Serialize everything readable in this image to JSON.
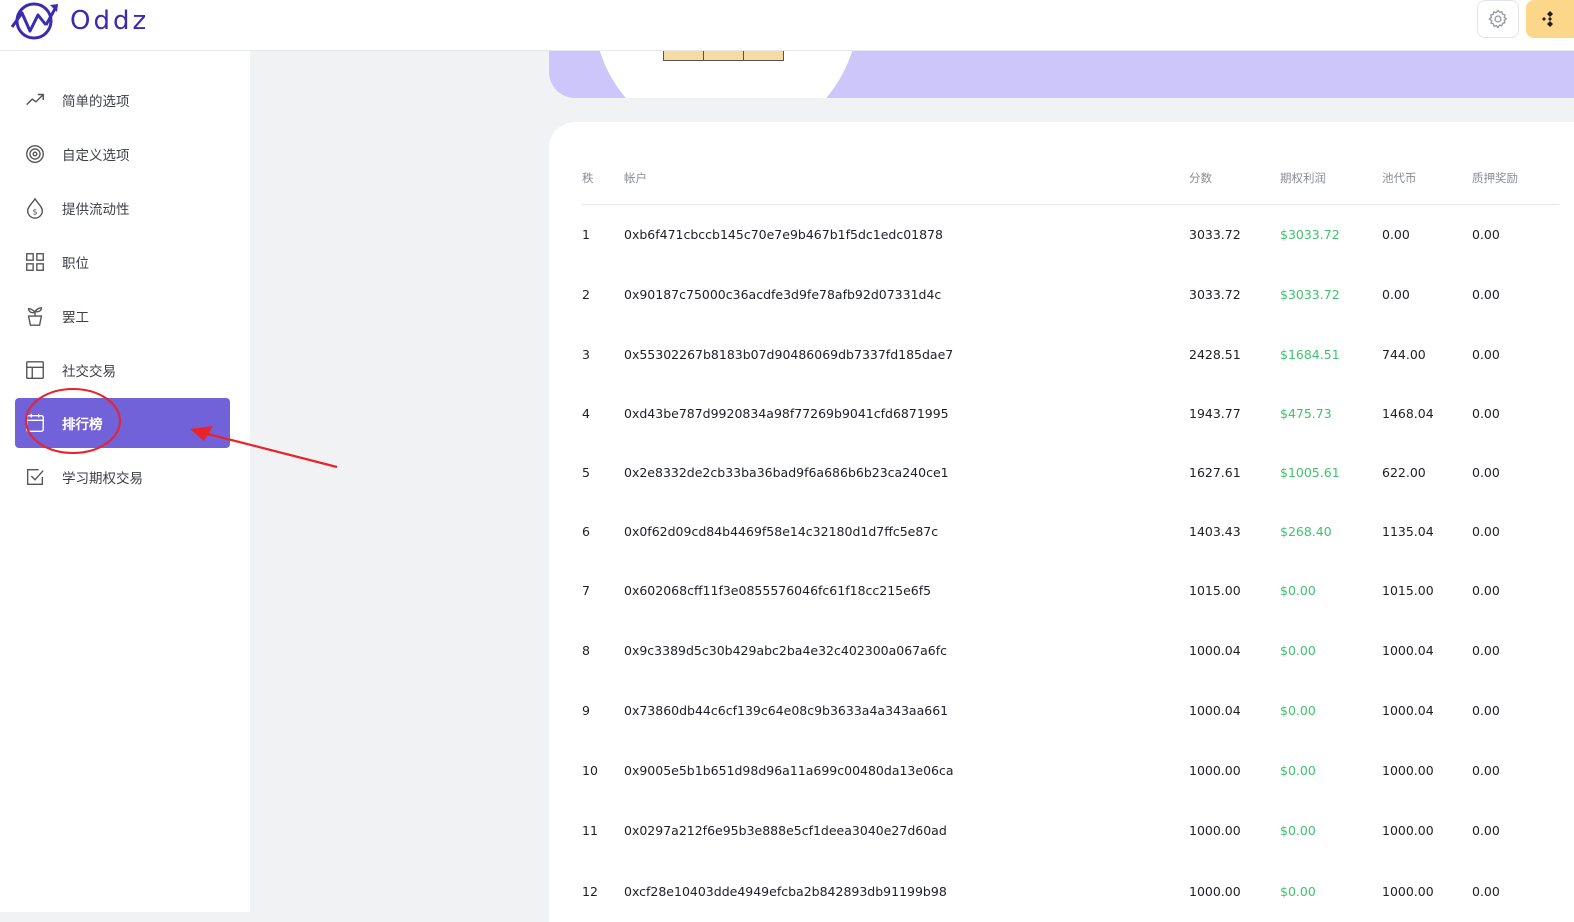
{
  "app": {
    "brand": "Oddz"
  },
  "colors": {
    "accent": "#7162d9",
    "profit_green": "#3ec46d",
    "banner": "#cdc6fb",
    "wallet": "#fcd78a",
    "annotation_red": "#e8232a"
  },
  "header": {
    "settings_icon": "gear-icon",
    "wallet_icon": "binance-icon"
  },
  "sidebar": {
    "items": [
      {
        "label": "简单的选项",
        "icon": "trending-up-icon"
      },
      {
        "label": "自定义选项",
        "icon": "target-icon"
      },
      {
        "label": "提供流动性",
        "icon": "dollar-drop-icon"
      },
      {
        "label": "职位",
        "icon": "grid-icon"
      },
      {
        "label": "罢工",
        "icon": "plant-pot-icon"
      },
      {
        "label": "社交交易",
        "icon": "layout-icon"
      },
      {
        "label": "排行榜",
        "icon": "calendar-icon",
        "active": true
      },
      {
        "label": "学习期权交易",
        "icon": "checkbox-icon"
      }
    ]
  },
  "leaderboard": {
    "columns": {
      "rank": "秩",
      "account": "帐户",
      "score": "分数",
      "option_profit": "期权利润",
      "pool_token": "池代币",
      "stake_reward": "质押奖励"
    },
    "rows": [
      {
        "rank": "1",
        "account": "0xb6f471cbccb145c70e7e9b467b1f5dc1edc01878",
        "score": "3033.72",
        "profit": "$3033.72",
        "pool": "0.00",
        "stake": "0.00"
      },
      {
        "rank": "2",
        "account": "0x90187c75000c36acdfe3d9fe78afb92d07331d4c",
        "score": "3033.72",
        "profit": "$3033.72",
        "pool": "0.00",
        "stake": "0.00"
      },
      {
        "rank": "3",
        "account": "0x55302267b8183b07d90486069db7337fd185dae7",
        "score": "2428.51",
        "profit": "$1684.51",
        "pool": "744.00",
        "stake": "0.00"
      },
      {
        "rank": "4",
        "account": "0xd43be787d9920834a98f77269b9041cfd6871995",
        "score": "1943.77",
        "profit": "$475.73",
        "pool": "1468.04",
        "stake": "0.00"
      },
      {
        "rank": "5",
        "account": "0x2e8332de2cb33ba36bad9f6a686b6b23ca240ce1",
        "score": "1627.61",
        "profit": "$1005.61",
        "pool": "622.00",
        "stake": "0.00"
      },
      {
        "rank": "6",
        "account": "0x0f62d09cd84b4469f58e14c32180d1d7ffc5e87c",
        "score": "1403.43",
        "profit": "$268.40",
        "pool": "1135.04",
        "stake": "0.00"
      },
      {
        "rank": "7",
        "account": "0x602068cff11f3e0855576046fc61f18cc215e6f5",
        "score": "1015.00",
        "profit": "$0.00",
        "pool": "1015.00",
        "stake": "0.00"
      },
      {
        "rank": "8",
        "account": "0x9c3389d5c30b429abc2ba4e32c402300a067a6fc",
        "score": "1000.04",
        "profit": "$0.00",
        "pool": "1000.04",
        "stake": "0.00"
      },
      {
        "rank": "9",
        "account": "0x73860db44c6cf139c64e08c9b3633a4a343aa661",
        "score": "1000.04",
        "profit": "$0.00",
        "pool": "1000.04",
        "stake": "0.00"
      },
      {
        "rank": "10",
        "account": "0x9005e5b1b651d98d96a11a699c00480da13e06ca",
        "score": "1000.00",
        "profit": "$0.00",
        "pool": "1000.00",
        "stake": "0.00"
      },
      {
        "rank": "11",
        "account": "0x0297a212f6e95b3e888e5cf1deea3040e27d60ad",
        "score": "1000.00",
        "profit": "$0.00",
        "pool": "1000.00",
        "stake": "0.00"
      },
      {
        "rank": "12",
        "account": "0xcf28e10403dde4949efcba2b842893db91199b98",
        "score": "1000.00",
        "profit": "$0.00",
        "pool": "1000.00",
        "stake": "0.00"
      }
    ]
  }
}
